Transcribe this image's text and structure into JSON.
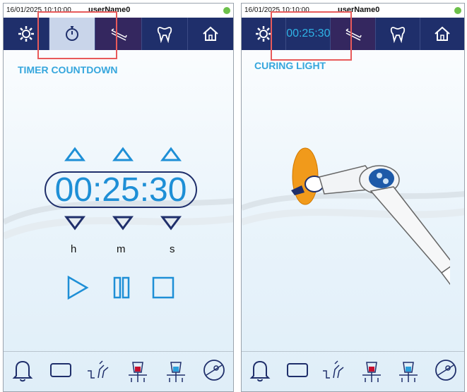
{
  "left_panel": {
    "status": {
      "datetime": "16/01/2025  10:10:00",
      "user": "userName0"
    },
    "toolbar": [
      "settings",
      "timer",
      "tools",
      "tooth",
      "home"
    ],
    "title": "TIMER COUNTDOWN",
    "timer": {
      "value": "00:25:30"
    },
    "units": {
      "h": "h",
      "m": "m",
      "s": "s"
    },
    "controls": [
      "play",
      "pause",
      "stop"
    ]
  },
  "right_panel": {
    "status": {
      "datetime": "16/01/2025  10:10:00",
      "user": "userName0"
    },
    "toolbar_time": "00:25:30",
    "title": "CURING LIGHT"
  },
  "colors": {
    "toolbar": "#1f2f6b",
    "accent": "#35a6dd",
    "highlight": "#e85a5a",
    "status_dot": "#6cc04a"
  },
  "bottom_icons": [
    "bell-icon",
    "rectangle-icon",
    "handpiece-icon",
    "cup-red-icon",
    "cup-blue-icon",
    "light-icon"
  ]
}
